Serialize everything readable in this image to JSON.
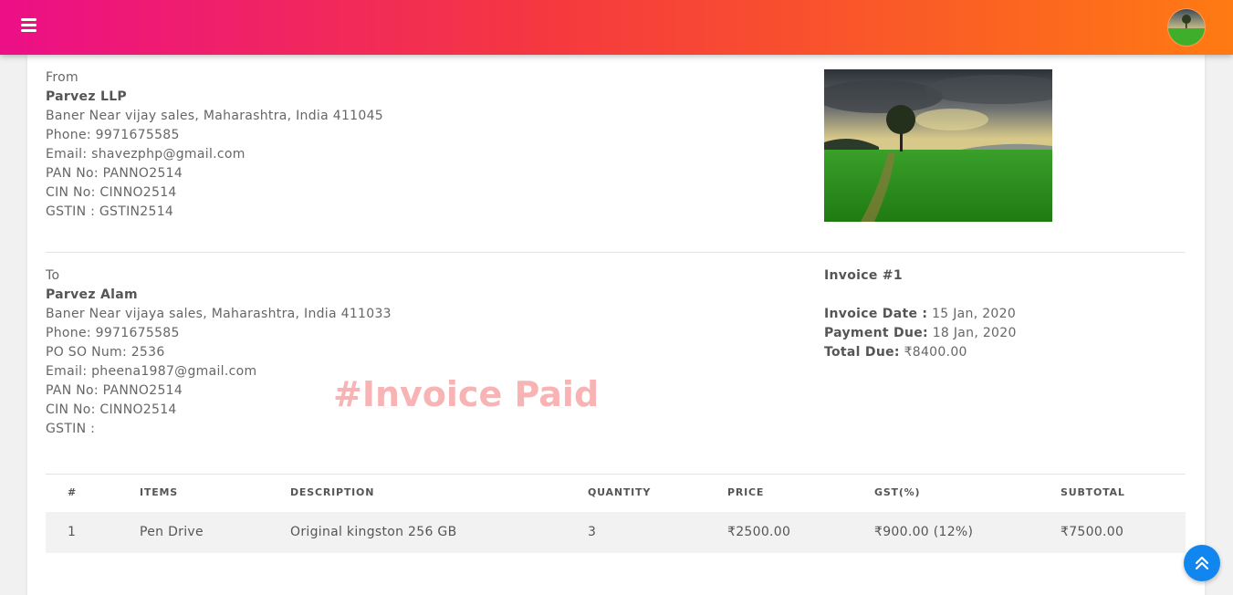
{
  "header": {
    "menu_icon": "hamburger-menu-icon",
    "avatar_icon": "user-avatar-landscape"
  },
  "colors": {
    "gradient_start": "#ec0f87",
    "gradient_end": "#ff7a12",
    "watermark": "#f8b4b4",
    "scroll_button": "#1186ee"
  },
  "from": {
    "label": "From",
    "name": "Parvez LLP",
    "address": "Baner Near vijay sales, Maharashtra, India 411045",
    "phone": "Phone: 9971675585",
    "email": "Email: shavezphp@gmail.com",
    "pan": "PAN No: PANNO2514",
    "cin": "CIN No: CINNO2514",
    "gstin": "GSTIN : GSTIN2514"
  },
  "to": {
    "label": "To",
    "name": "Parvez Alam",
    "address": "Baner Near vijaya sales, Maharashtra, India 411033",
    "phone": "Phone: 9971675585",
    "po": "PO SO Num: 2536",
    "email": "Email: pheena1987@gmail.com",
    "pan": "PAN No: PANNO2514",
    "cin": "CIN No: CINNO2514",
    "gstin": "GSTIN :"
  },
  "invoice": {
    "number": "Invoice #1",
    "date_label": "Invoice Date :",
    "date_value": " 15 Jan, 2020",
    "due_label": "Payment Due:",
    "due_value": " 18 Jan, 2020",
    "total_label": "Total Due:",
    "total_value": " ₹8400.00",
    "status_watermark": "#Invoice Paid"
  },
  "table": {
    "headers": [
      "#",
      "ITEMS",
      "DESCRIPTION",
      "QUANTITY",
      "PRICE",
      "GST(%)",
      "SUBTOTAL"
    ],
    "rows": [
      [
        "1",
        "Pen Drive",
        "Original kingston 256 GB",
        "3",
        "₹2500.00",
        "₹900.00 (12%)",
        "₹7500.00"
      ]
    ]
  },
  "scroll_top_icon": "double-chevron-up-icon"
}
